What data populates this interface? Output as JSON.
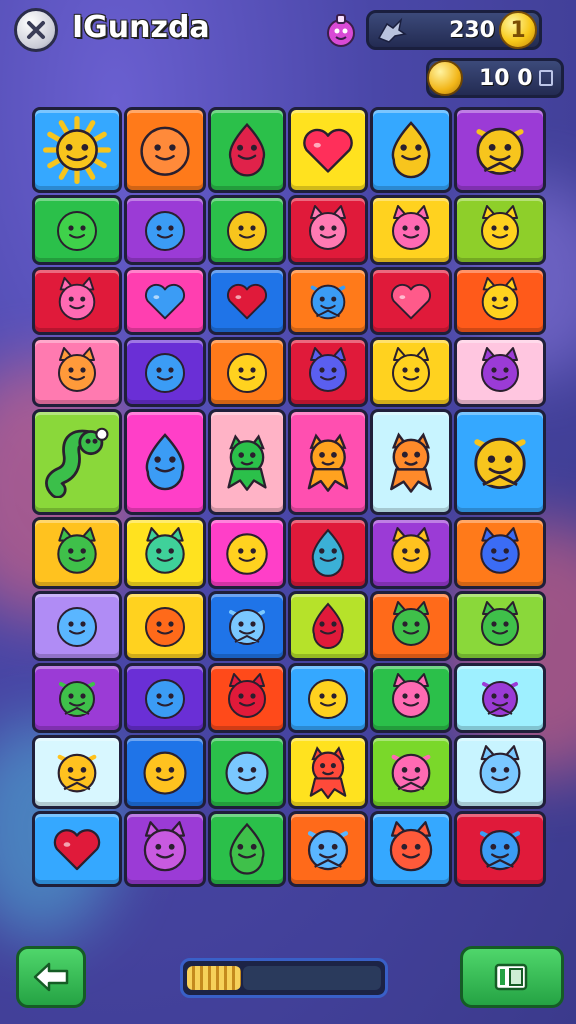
{
  "header": {
    "title": "IGunzda",
    "close_icon": "close-icon",
    "potion_icon": "potion-icon",
    "coin_bar": {
      "value": "230",
      "coin_symbol": "1",
      "left_icon": "dragon-icon"
    },
    "energy_bar": {
      "value": "10 0",
      "icon": "energy-icon"
    }
  },
  "board": {
    "columns": 6,
    "rows": 10,
    "tiles": [
      [
        {
          "bg": "#35a8ff",
          "fg": "#f7c51d",
          "icon": "sun"
        },
        {
          "bg": "#ff7a1a",
          "fg": "#ff8a3a",
          "icon": "face"
        },
        {
          "bg": "#2bc04a",
          "fg": "#e0224a",
          "icon": "drop"
        },
        {
          "bg": "#ffe21f",
          "fg": "#ff2f5a",
          "icon": "heart"
        },
        {
          "bg": "#35a8ff",
          "fg": "#f7c51d",
          "icon": "drop"
        },
        {
          "bg": "#9b3bd6",
          "fg": "#f7c51d",
          "icon": "fish"
        }
      ],
      [
        {
          "bg": "#2bc04a",
          "fg": "#3fd14a",
          "icon": "face"
        },
        {
          "bg": "#9b3bd6",
          "fg": "#3b9cf5",
          "icon": "face"
        },
        {
          "bg": "#2bc04a",
          "fg": "#f7c51d",
          "icon": "face"
        },
        {
          "bg": "#e01a3a",
          "fg": "#ff7ab3",
          "icon": "cat"
        },
        {
          "bg": "#ffd21f",
          "fg": "#ff6ab3",
          "icon": "cat"
        },
        {
          "bg": "#8ecf2a",
          "fg": "#ffd21f",
          "icon": "cat"
        }
      ],
      [
        {
          "bg": "#e01a3a",
          "fg": "#ff6ab3",
          "icon": "cat"
        },
        {
          "bg": "#ff3fb0",
          "fg": "#3b9cf5",
          "icon": "heart"
        },
        {
          "bg": "#1f74e8",
          "fg": "#e01a3a",
          "icon": "heart"
        },
        {
          "bg": "#ff7a1a",
          "fg": "#3b9cf5",
          "icon": "fish"
        },
        {
          "bg": "#e01a3a",
          "fg": "#ff5a8a",
          "icon": "heart"
        },
        {
          "bg": "#ff5a1a",
          "fg": "#ffd21f",
          "icon": "cat"
        }
      ],
      [
        {
          "bg": "#ff7ab0",
          "fg": "#ff9a3a",
          "icon": "cat"
        },
        {
          "bg": "#6a2fd6",
          "fg": "#3b9cf5",
          "icon": "face"
        },
        {
          "bg": "#ff7a1a",
          "fg": "#ffd21f",
          "icon": "face"
        },
        {
          "bg": "#e01a3a",
          "fg": "#5a5ff0",
          "icon": "cat"
        },
        {
          "bg": "#ffd21f",
          "fg": "#ffd21f",
          "icon": "cat"
        },
        {
          "bg": "#ffc6e0",
          "fg": "#9b3bd6",
          "icon": "cat"
        }
      ],
      [
        {
          "bg": "#8ad83a",
          "fg": "#3bbf4a",
          "icon": "worm"
        },
        {
          "bg": "#ff3fc8",
          "fg": "#3b9cf5",
          "icon": "drop"
        },
        {
          "bg": "#ffb3c6",
          "fg": "#2bc04a",
          "icon": "monster"
        },
        {
          "bg": "#ff4fb0",
          "fg": "#ffa21f",
          "icon": "monster"
        },
        {
          "bg": "#c8f4ff",
          "fg": "#ff8a2a",
          "icon": "monster"
        },
        {
          "bg": "#35a8ff",
          "fg": "#f7c51d",
          "icon": "fish"
        }
      ],
      [
        {
          "bg": "#ffc21f",
          "fg": "#3fc04a",
          "icon": "cat"
        },
        {
          "bg": "#ffe21f",
          "fg": "#3fd19a",
          "icon": "cat"
        },
        {
          "bg": "#ff3fc8",
          "fg": "#ffd21f",
          "icon": "face"
        },
        {
          "bg": "#e01a3a",
          "fg": "#3bb0d6",
          "icon": "drop"
        },
        {
          "bg": "#9b3bd6",
          "fg": "#ffc21f",
          "icon": "cat"
        },
        {
          "bg": "#ff7a1a",
          "fg": "#3b6cf5",
          "icon": "cat"
        }
      ],
      [
        {
          "bg": "#b08cf5",
          "fg": "#5ab6ff",
          "icon": "face"
        },
        {
          "bg": "#ffd21f",
          "fg": "#ff6a1a",
          "icon": "face"
        },
        {
          "bg": "#1f74e8",
          "fg": "#7ac8ff",
          "icon": "fish"
        },
        {
          "bg": "#b6e22a",
          "fg": "#e01a3a",
          "icon": "drop"
        },
        {
          "bg": "#ff6a1a",
          "fg": "#3fc04a",
          "icon": "cat"
        },
        {
          "bg": "#8ad83a",
          "fg": "#3fc04a",
          "icon": "cat"
        }
      ],
      [
        {
          "bg": "#9b3bd6",
          "fg": "#3fc04a",
          "icon": "fish"
        },
        {
          "bg": "#6a2fd6",
          "fg": "#3b9cf5",
          "icon": "face"
        },
        {
          "bg": "#ff4a1a",
          "fg": "#e01a3a",
          "icon": "cat"
        },
        {
          "bg": "#35a8ff",
          "fg": "#ffd21f",
          "icon": "face"
        },
        {
          "bg": "#2bc04a",
          "fg": "#ff6ab3",
          "icon": "cat"
        },
        {
          "bg": "#9ef0ff",
          "fg": "#9b3bd6",
          "icon": "fish"
        }
      ],
      [
        {
          "bg": "#d8f7ff",
          "fg": "#ffc21f",
          "icon": "fish"
        },
        {
          "bg": "#1f74e8",
          "fg": "#ffc21f",
          "icon": "face"
        },
        {
          "bg": "#2bc04a",
          "fg": "#7ac8ff",
          "icon": "face"
        },
        {
          "bg": "#ffe21f",
          "fg": "#ff4a3a",
          "icon": "monster"
        },
        {
          "bg": "#7ad82a",
          "fg": "#ff6ab3",
          "icon": "fish"
        },
        {
          "bg": "#c8f4ff",
          "fg": "#7ac8ff",
          "icon": "cat"
        }
      ],
      [
        {
          "bg": "#35a8ff",
          "fg": "#e01a3a",
          "icon": "heart"
        },
        {
          "bg": "#9b3bd6",
          "fg": "#c85ae0",
          "icon": "cat"
        },
        {
          "bg": "#2bc04a",
          "fg": "#3fc04a",
          "icon": "drop"
        },
        {
          "bg": "#ff6a1a",
          "fg": "#5ab6ff",
          "icon": "fish"
        },
        {
          "bg": "#35a8ff",
          "fg": "#ff5a3a",
          "icon": "cat"
        },
        {
          "bg": "#e01a3a",
          "fg": "#3b9cf5",
          "icon": "fish"
        }
      ]
    ]
  },
  "footer": {
    "back_icon": "back-arrow-icon",
    "progress": 0.28,
    "exit_icon": "exit-icon"
  }
}
